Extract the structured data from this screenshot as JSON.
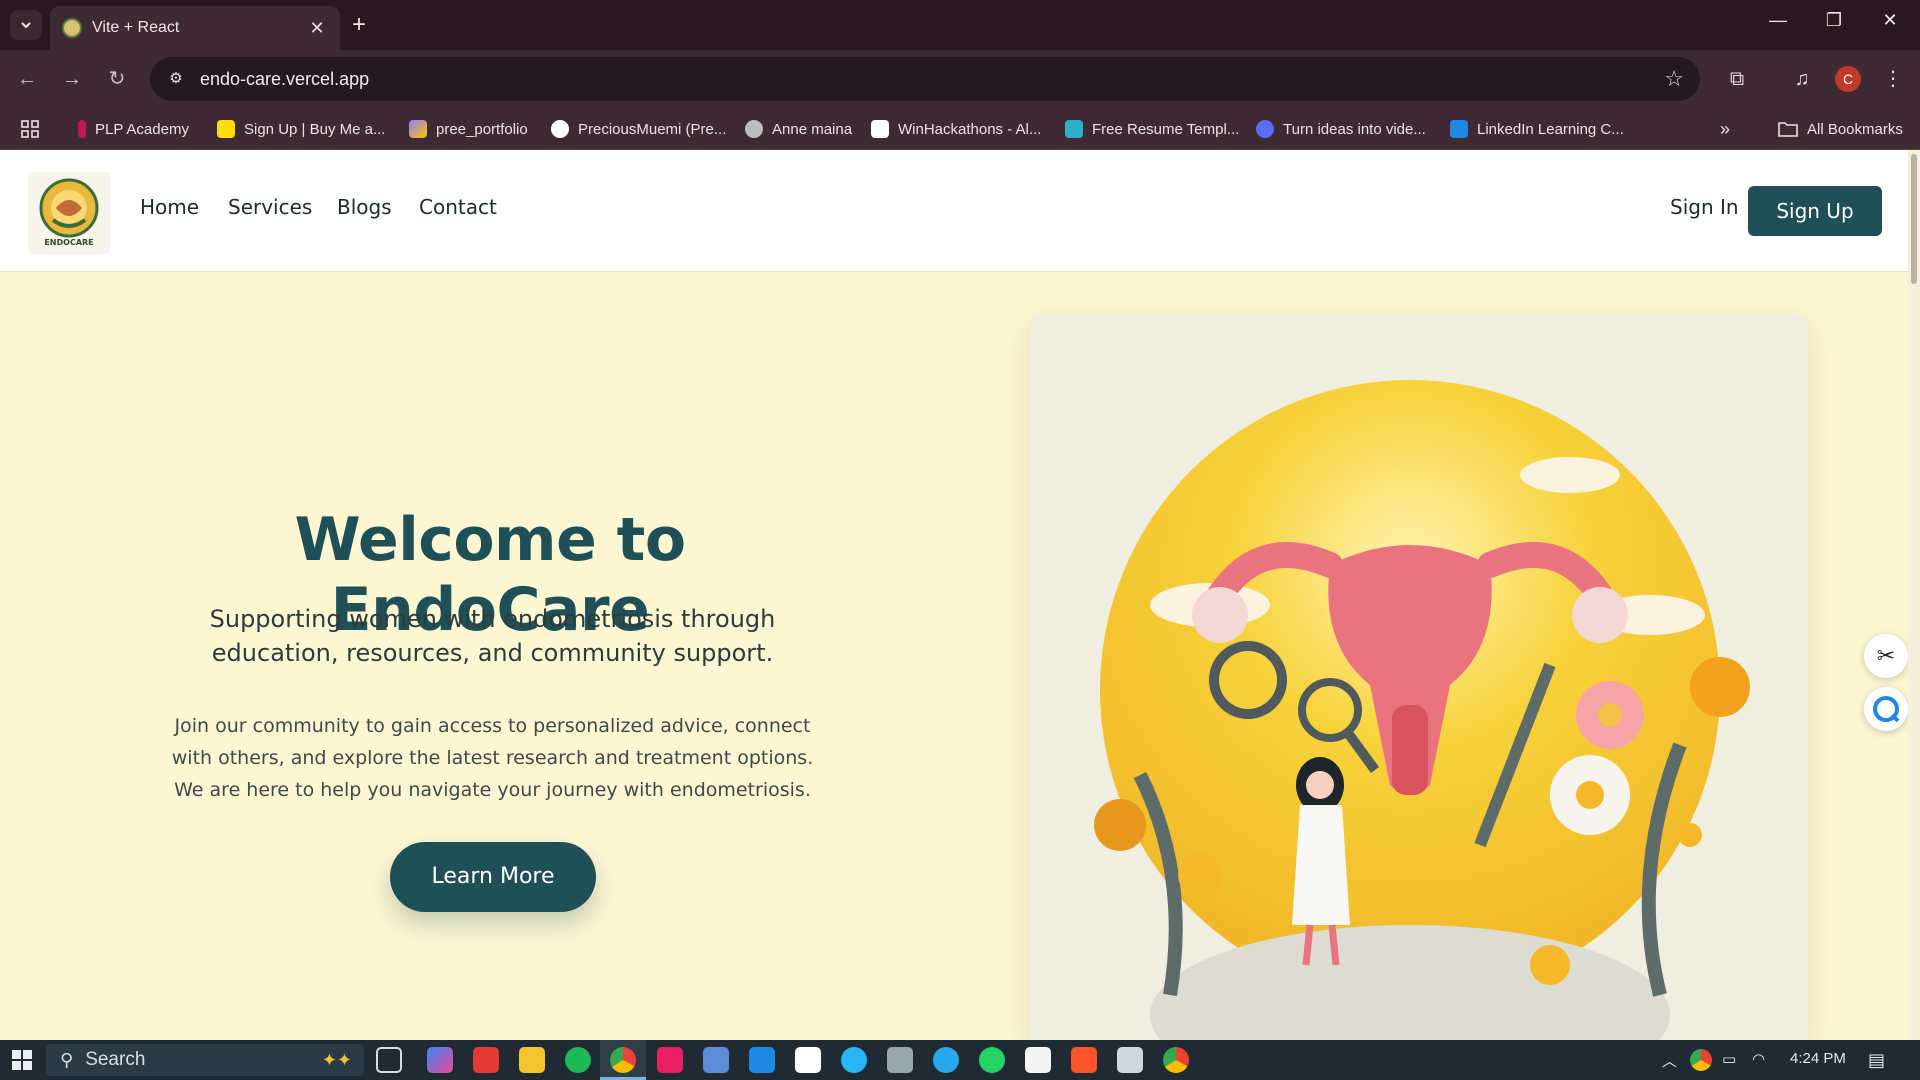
{
  "browser": {
    "tab_title": "Vite + React",
    "url": "endo-care.vercel.app",
    "profile_initial": "C",
    "bookmarks": [
      {
        "label": "PLP Academy",
        "color": "#c2185b"
      },
      {
        "label": "Sign Up | Buy Me a...",
        "color": "#ffdd00"
      },
      {
        "label": "pree_portfolio",
        "color": "#8e7cff"
      },
      {
        "label": "PreciousMuemi (Pre...",
        "color": "#ffffff"
      },
      {
        "label": "Anne maina",
        "color": "#bdbdbd"
      },
      {
        "label": "WinHackathons - Al...",
        "color": "#ffffff"
      },
      {
        "label": "Free Resume Templ...",
        "color": "#2bb0c8"
      },
      {
        "label": "Turn ideas into vide...",
        "color": "#5a6cff"
      },
      {
        "label": "LinkedIn Learning C...",
        "color": "#1e88e5"
      }
    ],
    "all_bookmarks": "All Bookmarks"
  },
  "site": {
    "logo_text": "ENDOCARE",
    "nav": [
      "Home",
      "Services",
      "Blogs",
      "Contact"
    ],
    "sign_in": "Sign In",
    "sign_up": "Sign Up"
  },
  "hero": {
    "title": "Welcome to EndoCare",
    "subtitle": "Supporting women with endometriosis through education, resources, and community support.",
    "body": "Join our community to gain access to personalized advice, connect with others, and explore the latest research and treatment options. We are here to help you navigate your journey with endometriosis.",
    "cta": "Learn More"
  },
  "taskbar": {
    "search_placeholder": "Search",
    "time": "4:24 PM"
  },
  "colors": {
    "brand": "#1f5057",
    "hero_bg": "#fdf6d2",
    "chrome_bg": "#3d2a33"
  }
}
